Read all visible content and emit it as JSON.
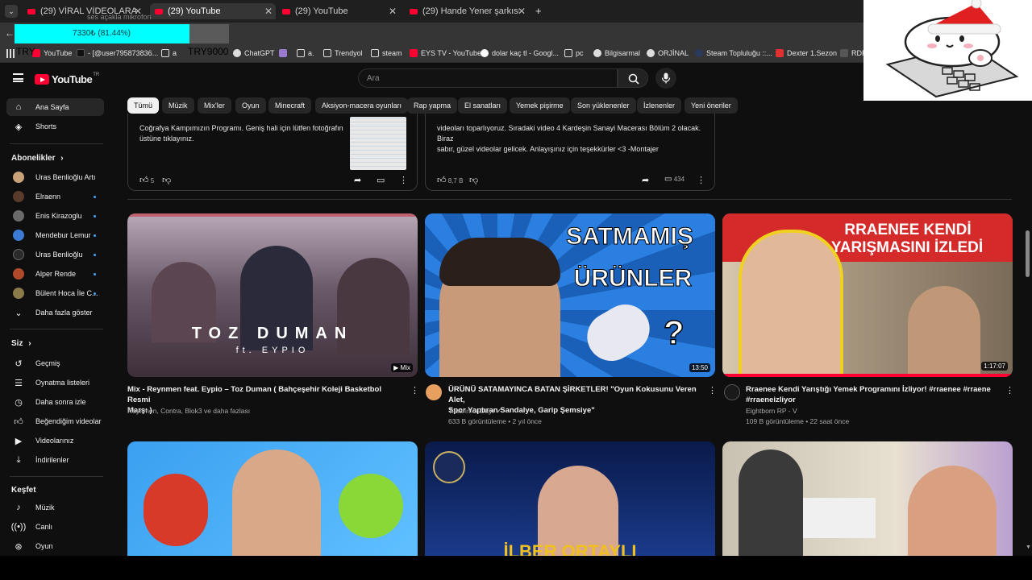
{
  "browser": {
    "tabs": [
      {
        "title": "(29) VİRAL VİDEOLARA TEPKİ",
        "active": false
      },
      {
        "title": "(29) YouTube",
        "active": true
      },
      {
        "title": "(29) YouTube",
        "active": false
      },
      {
        "title": "(29) Hande Yener şarkısı Türk s",
        "active": false
      }
    ],
    "new_tab": "+",
    "bookmarks": [
      "YouTube",
      "- [@user795873836...",
      "a",
      "TRY9000",
      "ChatGPT",
      "a.",
      "Trendyol",
      "steam",
      "EYS TV - YouTube",
      "dolar kaç tl - Googl...",
      "pc",
      "Bilgisarmal",
      "ORJİNAL",
      "Steam Topluluğu ::...",
      "Dexter 1.Sezon",
      "RDR"
    ]
  },
  "overlay": {
    "progress_label": "7330₺ (81.44%)",
    "progress_fraction": 0.8144,
    "top_caption": "ses açakla mikrofon",
    "left_tag": "TRY",
    "right_tag": "TRY9000"
  },
  "youtube": {
    "logo": "YouTube",
    "region": "TR",
    "search_placeholder": "Ara"
  },
  "sidebar": {
    "main": [
      {
        "label": "Ana Sayfa",
        "icon": "home-icon",
        "active": true
      },
      {
        "label": "Shorts",
        "icon": "shorts-icon",
        "active": false
      }
    ],
    "subs_heading": "Abonelikler",
    "subs": [
      {
        "label": "Uras Benlioğlu Artı",
        "color": "#c9a27a",
        "dot": false
      },
      {
        "label": "Elraenn",
        "color": "#5a3a2a",
        "dot": true
      },
      {
        "label": "Enis Kirazoglu",
        "color": "#6a6a6a",
        "dot": true
      },
      {
        "label": "Mendebur Lemur",
        "color": "#3b7bd4",
        "dot": true
      },
      {
        "label": "Uras Benlioğlu",
        "color": "#2a2a2a",
        "dot": true
      },
      {
        "label": "Alper Rende",
        "color": "#b04a2a",
        "dot": true
      },
      {
        "label": "Bülent Hoca İle C...",
        "color": "#8a7a4a",
        "dot": true
      }
    ],
    "show_more": "Daha fazla göster",
    "you_heading": "Siz",
    "you": [
      {
        "label": "Geçmiş",
        "icon": "history-icon"
      },
      {
        "label": "Oynatma listeleri",
        "icon": "playlist-icon"
      },
      {
        "label": "Daha sonra izle",
        "icon": "watch-later-icon"
      },
      {
        "label": "Beğendiğim videolar",
        "icon": "liked-icon"
      },
      {
        "label": "Videolarınız",
        "icon": "your-videos-icon"
      },
      {
        "label": "İndirilenler",
        "icon": "download-icon"
      }
    ],
    "explore_heading": "Keşfet",
    "explore": [
      {
        "label": "Müzik",
        "icon": "music-icon"
      },
      {
        "label": "Canlı",
        "icon": "live-icon"
      },
      {
        "label": "Oyun",
        "icon": "gaming-icon"
      }
    ]
  },
  "chips": [
    "Tümü",
    "Müzik",
    "Mix'ler",
    "Oyun",
    "Minecraft",
    "Aksiyon-macera oyunları",
    "Rap yapma",
    "El sanatları",
    "Yemek pişirme",
    "Son yüklenenler",
    "İzlenenler",
    "Yeni öneriler"
  ],
  "posts": [
    {
      "line1": "Coğrafya Kampımızın Programı. Geniş hali için lütfen fotoğrafın",
      "line2": "üstüne tıklayınız.",
      "likes": "5",
      "comments": ""
    },
    {
      "line1": "videoları toparlıyoruz. Sıradaki video 4 Kardeşin Sanayi Macerası Bölüm 2 olacak. Biraz",
      "line2": "sabır, güzel videolar gelicek. Anlayışınız için teşekkürler <3 -Montajer",
      "likes": "8,7 B",
      "comments": "434"
    }
  ],
  "videos": [
    {
      "thumb_text": "TOZ DUMAN",
      "thumb_sub": "ft. EYPIO",
      "badge": "Mix",
      "title1": "Mix - Reynmen feat. Eypio – Toz Duman ( Bahçeşehir Koleji Basketbol Resmi",
      "title2": "Marşı )",
      "channel": "Reynmen, Contra, Blok3 ve daha fazlası",
      "stats": ""
    },
    {
      "thumb_text1": "SATMAMIŞ",
      "thumb_text2": "ÜRÜNLER",
      "duration": "13:50",
      "title1": "ÜRÜNÜ SATAMAYINCA BATAN ŞİRKETLER! \"Oyun Kokusunu Veren Alet,",
      "title2": "Spor Yaptıran Sandalye, Garip Şemsiye\"",
      "channel": "Tasarımcı Dayı",
      "stats": "633 B görüntüleme • 2 yıl önce"
    },
    {
      "thumb_text1": "RRAENEE KENDİ",
      "thumb_text2": "YARIŞMASINI İZLEDİ",
      "duration": "1:17:07",
      "title1": "Rraenee Kendi Yarıştığı Yemek Programını İzliyor! #rraenee #rraene",
      "title2": "#rraeneizliyor",
      "channel": "Eightborn RP - V",
      "stats": "109 B görüntüleme • 22 saat önce"
    }
  ],
  "row2": {
    "thumb2_text": "İLBER ORTAYLI"
  }
}
